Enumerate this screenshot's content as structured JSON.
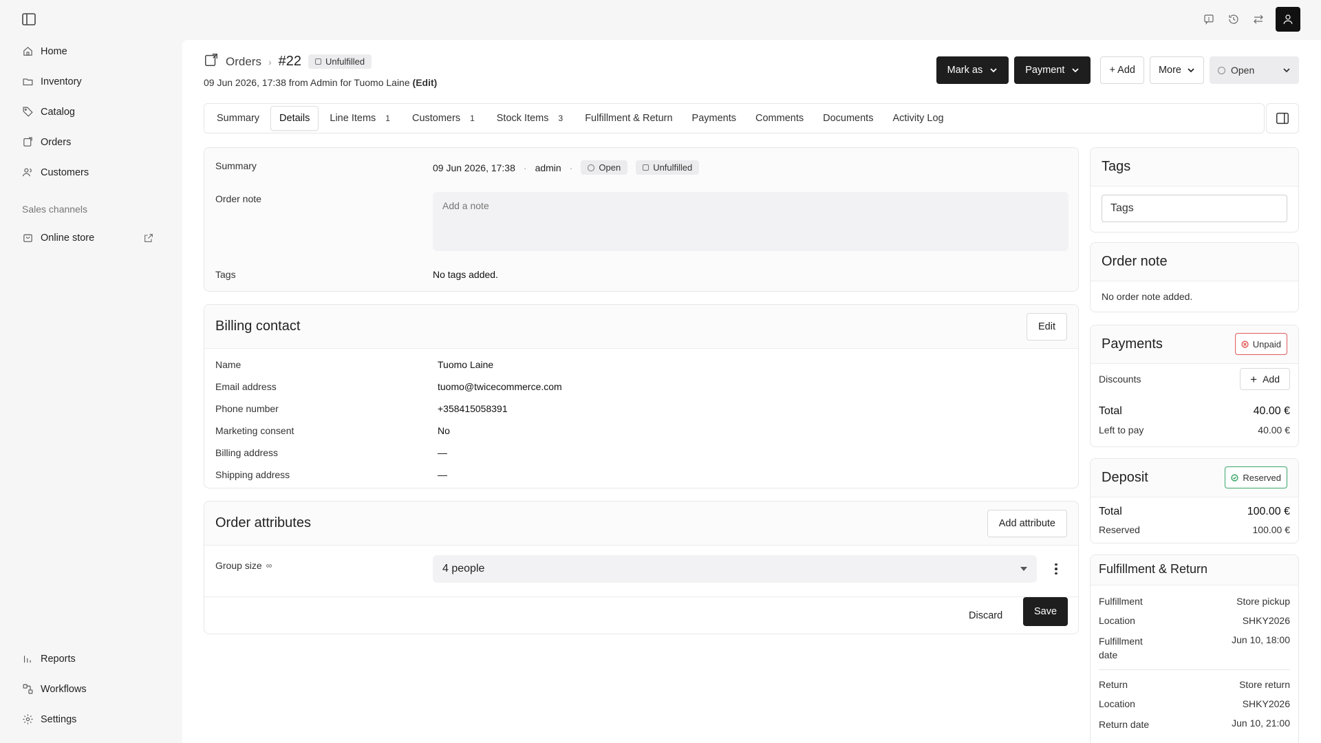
{
  "colors": {
    "accent": "#1e1e1e",
    "unpaid": "#e15a5a",
    "reserved": "#3aa56a"
  },
  "icons": {
    "sidebar_toggle": "sidebar-toggle-icon",
    "top": [
      "chat-icon",
      "history-icon",
      "swap-icon",
      "user-icon"
    ]
  },
  "sidebar": {
    "items": [
      {
        "label": "Home",
        "icon": "home-icon"
      },
      {
        "label": "Inventory",
        "icon": "folder-icon"
      },
      {
        "label": "Catalog",
        "icon": "tag-icon"
      },
      {
        "label": "Orders",
        "icon": "orders-icon"
      },
      {
        "label": "Customers",
        "icon": "users-icon"
      }
    ],
    "section_label": "Sales channels",
    "channel": {
      "label": "Online store",
      "icon": "store-icon"
    },
    "bottom": [
      {
        "label": "Reports",
        "icon": "chart-icon"
      },
      {
        "label": "Workflows",
        "icon": "workflow-icon"
      },
      {
        "label": "Settings",
        "icon": "gear-icon"
      }
    ]
  },
  "header": {
    "crumb_root": "Orders",
    "order_number": "#22",
    "fulfillment_badge": "Unfulfilled",
    "subline": "09 Jun 2026, 17:38 from Admin for Tuomo Laine",
    "edit_label": "(Edit)",
    "actions": {
      "mark_as": "Mark as",
      "payment": "Payment",
      "add": "+ Add",
      "more": "More",
      "status": "Open"
    }
  },
  "tabs": [
    {
      "label": "Summary",
      "count": ""
    },
    {
      "label": "Details",
      "count": ""
    },
    {
      "label": "Line Items",
      "count": "1"
    },
    {
      "label": "Customers",
      "count": "1"
    },
    {
      "label": "Stock Items",
      "count": "3"
    },
    {
      "label": "Fulfillment & Return",
      "count": ""
    },
    {
      "label": "Payments",
      "count": ""
    },
    {
      "label": "Comments",
      "count": ""
    },
    {
      "label": "Documents",
      "count": ""
    },
    {
      "label": "Activity Log",
      "count": ""
    }
  ],
  "summary": {
    "label": "Summary",
    "date": "09 Jun 2026, 17:38",
    "dot": "·",
    "user": "admin",
    "status": "Open",
    "fulfillment": "Unfulfilled",
    "note_label": "Order note",
    "note_placeholder": "Add a note",
    "tags_label": "Tags",
    "tags_value": "No tags added."
  },
  "billing": {
    "title": "Billing contact",
    "edit": "Edit",
    "rows": [
      {
        "label": "Name",
        "value": "Tuomo Laine"
      },
      {
        "label": "Email address",
        "value": "tuomo@twicecommerce.com"
      },
      {
        "label": "Phone number",
        "value": "+358415058391"
      },
      {
        "label": "Marketing consent",
        "value": "No"
      },
      {
        "label": "Billing address",
        "value": "—"
      },
      {
        "label": "Shipping address",
        "value": "—"
      }
    ]
  },
  "attributes": {
    "title": "Order attributes",
    "add": "Add attribute",
    "group_label": "Group size",
    "group_value": "4 people",
    "discard": "Discard",
    "save": "Save"
  },
  "right": {
    "tags": {
      "title": "Tags",
      "placeholder": "Tags"
    },
    "order_note": {
      "title": "Order note",
      "value": "No order note added."
    },
    "payments": {
      "title": "Payments",
      "badge": "Unpaid",
      "discounts_label": "Discounts",
      "add": "Add",
      "total_label": "Total",
      "total_value": "40.00 €",
      "left_label": "Left to pay",
      "left_value": "40.00 €"
    },
    "deposit": {
      "title": "Deposit",
      "badge": "Reserved",
      "total_label": "Total",
      "total_value": "100.00 €",
      "reserved_label": "Reserved",
      "reserved_value": "100.00 €"
    },
    "fulfillment": {
      "title": "Fulfillment & Return",
      "rows": [
        {
          "label": "Fulfillment",
          "value": "Store pickup"
        },
        {
          "label": "Location",
          "value": "SHKY2026"
        },
        {
          "label": "Fulfillment date",
          "value": "Jun 10, 18:00"
        }
      ],
      "return_rows": [
        {
          "label": "Return",
          "value": "Store return"
        },
        {
          "label": "Location",
          "value": "SHKY2026"
        },
        {
          "label": "Return date",
          "value": "Jun 10, 21:00"
        }
      ]
    }
  }
}
